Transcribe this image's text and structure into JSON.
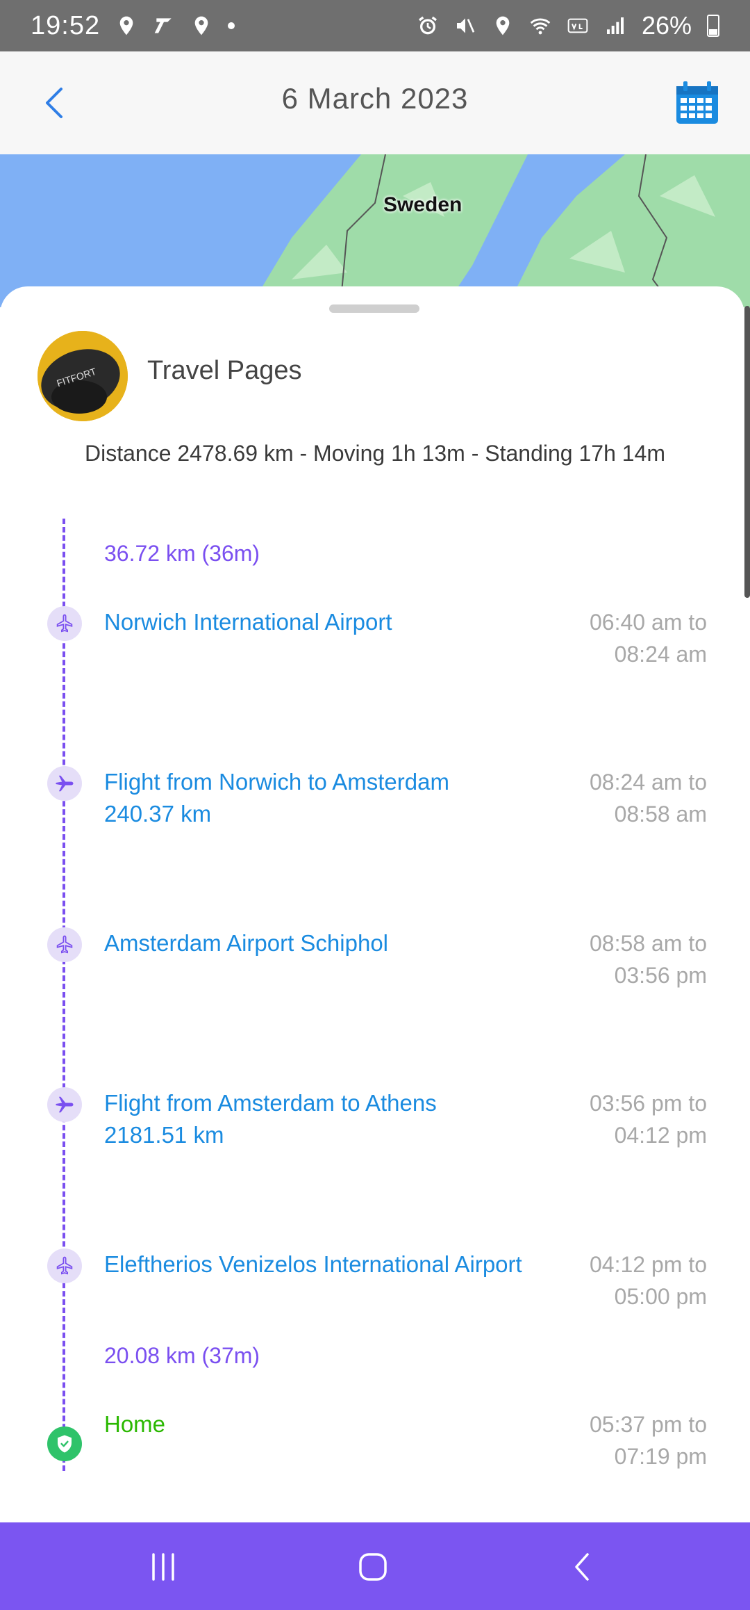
{
  "status_bar": {
    "time": "19:52",
    "battery": "26%"
  },
  "header": {
    "title": "6 March 2023"
  },
  "map": {
    "label": "Sweden"
  },
  "profile": {
    "name": "Travel Pages",
    "avatar_text": "FITFORT"
  },
  "summary": "Distance 2478.69 km - Moving 1h 13m - Standing 17h 14m",
  "timeline": {
    "segment_start": "36.72 km (36m)",
    "segment_end": "20.08 km (37m)",
    "entries": [
      {
        "name": "Norwich International Airport",
        "name2": "",
        "time1": "06:40 am to",
        "time2": "08:24 am",
        "icon": "airport-icon"
      },
      {
        "name": "Flight from Norwich to Amsterdam",
        "name2": "240.37 km",
        "time1": "08:24 am to",
        "time2": "08:58 am",
        "icon": "flight-icon"
      },
      {
        "name": "Amsterdam Airport Schiphol",
        "name2": "",
        "time1": "08:58 am to",
        "time2": "03:56 pm",
        "icon": "airport-icon"
      },
      {
        "name": "Flight from Amsterdam to Athens",
        "name2": "2181.51 km",
        "time1": "03:56 pm to",
        "time2": "04:12 pm",
        "icon": "flight-icon"
      },
      {
        "name": "Eleftherios Venizelos International Airport",
        "name2": "",
        "time1": "04:12 pm to",
        "time2": "05:00 pm",
        "icon": "airport-icon"
      },
      {
        "name": "Home",
        "name2": "",
        "time1": "05:37 pm to",
        "time2": "07:19 pm",
        "icon": "home-check-icon"
      }
    ]
  },
  "colors": {
    "accent": "#7a4ff0",
    "link": "#1a8be0",
    "home": "#2ab800",
    "nav": "#7b55f1"
  }
}
